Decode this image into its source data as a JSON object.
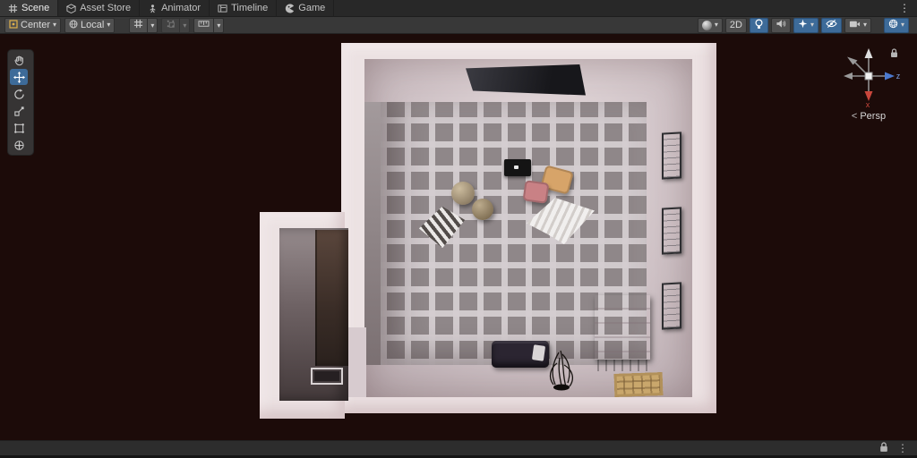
{
  "window": {
    "tab_bar_menu_icon": "⋮"
  },
  "tabs": {
    "items": [
      {
        "label": "Scene"
      },
      {
        "label": "Asset Store"
      },
      {
        "label": "Animator"
      },
      {
        "label": "Timeline"
      },
      {
        "label": "Game"
      }
    ]
  },
  "toolbar": {
    "pivot_label": "Center",
    "space_label": "Local",
    "dropdown_arrow": "▾",
    "view_2d_label": "2D"
  },
  "scene_gizmo": {
    "persp_arrow": "<",
    "persp_label": "Persp",
    "axis_x_label": "x",
    "axis_z_label": "z"
  },
  "status_bar": {
    "menu_icon": "⋮"
  },
  "colors": {
    "selection_accent": "#3d6b99",
    "scene_background": "#1c0b09",
    "wall": "#ece2e3",
    "carpet_base": "#8f8789",
    "carpet_line": "#d4cdd0"
  }
}
